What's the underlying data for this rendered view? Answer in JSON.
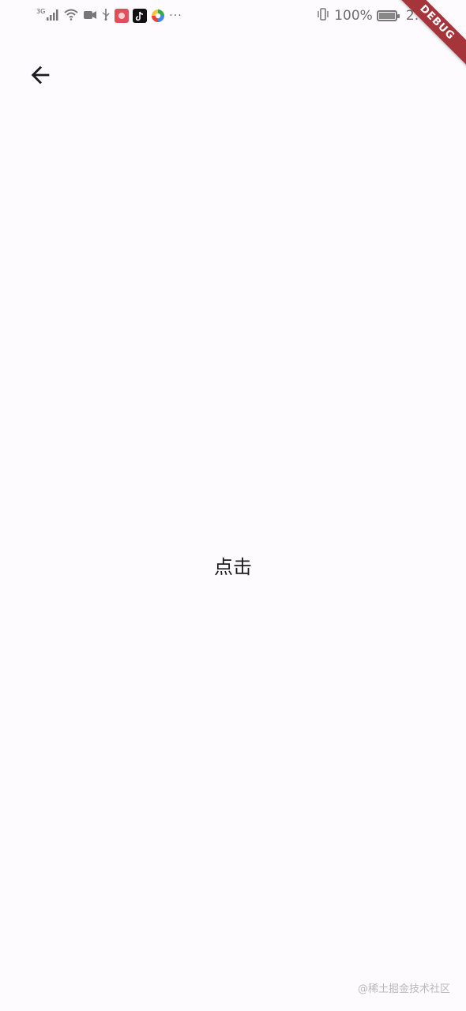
{
  "status_bar": {
    "network_label": "3G",
    "battery_text": "100%",
    "battery_level": 1.0,
    "time": "2:05",
    "more_indicator": "···",
    "icons": [
      "signal-icon",
      "wifi-icon",
      "video-icon",
      "usb-icon",
      "app-red-icon",
      "tiktok-icon",
      "app-color-icon",
      "vibrate-icon",
      "battery-icon"
    ]
  },
  "app_bar": {
    "back_icon": "arrow-back-icon"
  },
  "body": {
    "center_label": "点击"
  },
  "debug_banner": {
    "label": "DEBUG",
    "color": "#a6353b"
  },
  "watermark": {
    "text": "@稀土掘金技术社区"
  },
  "colors": {
    "background": "#fefbfe",
    "text": "#1c1b1f"
  }
}
